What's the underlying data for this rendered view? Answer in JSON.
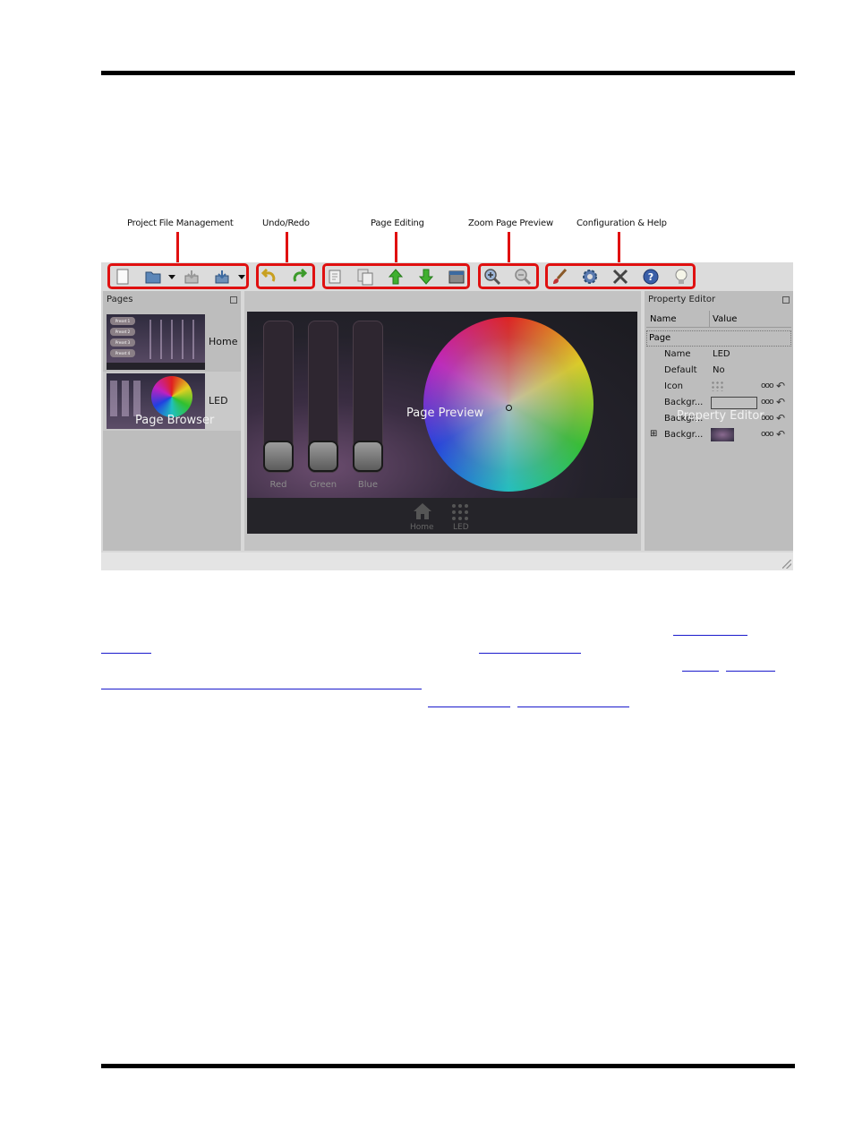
{
  "callouts": {
    "project_file": "Project File Management",
    "undo_redo": "Undo/Redo",
    "page_editing": "Page Editing",
    "zoom": "Zoom Page Preview",
    "config": "Configuration & Help"
  },
  "toolbar": {
    "icons": [
      "new-file-icon",
      "open-folder-icon",
      "save-icon",
      "save-as-icon",
      "undo-icon",
      "redo-icon",
      "new-page-icon",
      "copy-page-icon",
      "move-up-icon",
      "move-down-icon",
      "page-settings-icon",
      "zoom-in-icon",
      "zoom-out-icon",
      "theme-brush-icon",
      "settings-gear-icon",
      "tools-icon",
      "help-icon",
      "tips-bulb-icon"
    ]
  },
  "pages_panel": {
    "title": "Pages",
    "items": [
      {
        "label": "Home",
        "thumb_buttons": [
          "Preset 1",
          "Preset 2",
          "Preset 3",
          "Preset 4"
        ]
      },
      {
        "label": "LED"
      }
    ],
    "overlay": "Page Browser"
  },
  "preview": {
    "overlay": "Page Preview",
    "sliders": [
      "Red",
      "Green",
      "Blue"
    ],
    "nav": [
      "Home",
      "LED"
    ]
  },
  "property_editor": {
    "title": "Property Editor",
    "col_name": "Name",
    "col_value": "Value",
    "section": "Page",
    "rows": [
      {
        "name": "Name",
        "value": "LED"
      },
      {
        "name": "Default",
        "value": "No"
      },
      {
        "name": "Icon",
        "value": ""
      },
      {
        "name": "Backgr...",
        "value": ""
      },
      {
        "name": "Backgr...",
        "value": ""
      },
      {
        "name": "Backgr...",
        "value": ""
      }
    ],
    "dots": "ooo",
    "overlay": "Property Editor"
  },
  "colors": {
    "callout_red": "#e01010",
    "link_blue": "#1a1acc"
  }
}
